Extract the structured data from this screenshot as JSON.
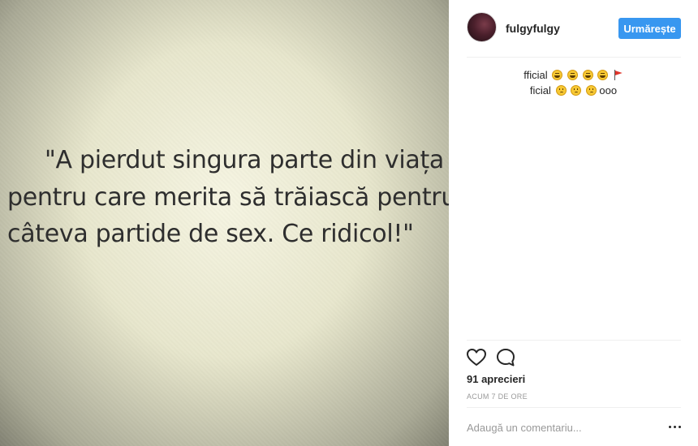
{
  "post": {
    "quote_lines": [
      "\"A pierdut singura parte din viața sa",
      "pentru care merita să trăiască pentru",
      "câteva partide de sex. Ce ridicol!\""
    ]
  },
  "header": {
    "avatar_icon": "user-avatar-photo",
    "username": "fulgyfulgy",
    "follow_label": "Urmărește",
    "follow_color": "#3897f0"
  },
  "comments": [
    {
      "text": "fficial",
      "emojis": [
        "laughing-cat-emoji",
        "laughing-cat-emoji",
        "laughing-cat-emoji",
        "laughing-cat-emoji",
        "red-flag-emoji"
      ]
    },
    {
      "text": "ficial",
      "emojis": [
        "worried-face-emoji",
        "worried-face-emoji",
        "worried-face-emoji"
      ],
      "suffix": "ooo"
    }
  ],
  "actions": {
    "like_icon": "heart-icon",
    "comment_icon": "speech-bubble-icon"
  },
  "likes": "91 aprecieri",
  "timestamp": "ACUM 7 DE ORE",
  "add_comment": {
    "placeholder": "Adaugă un comentariu...",
    "more_icon": "more-options-icon"
  }
}
